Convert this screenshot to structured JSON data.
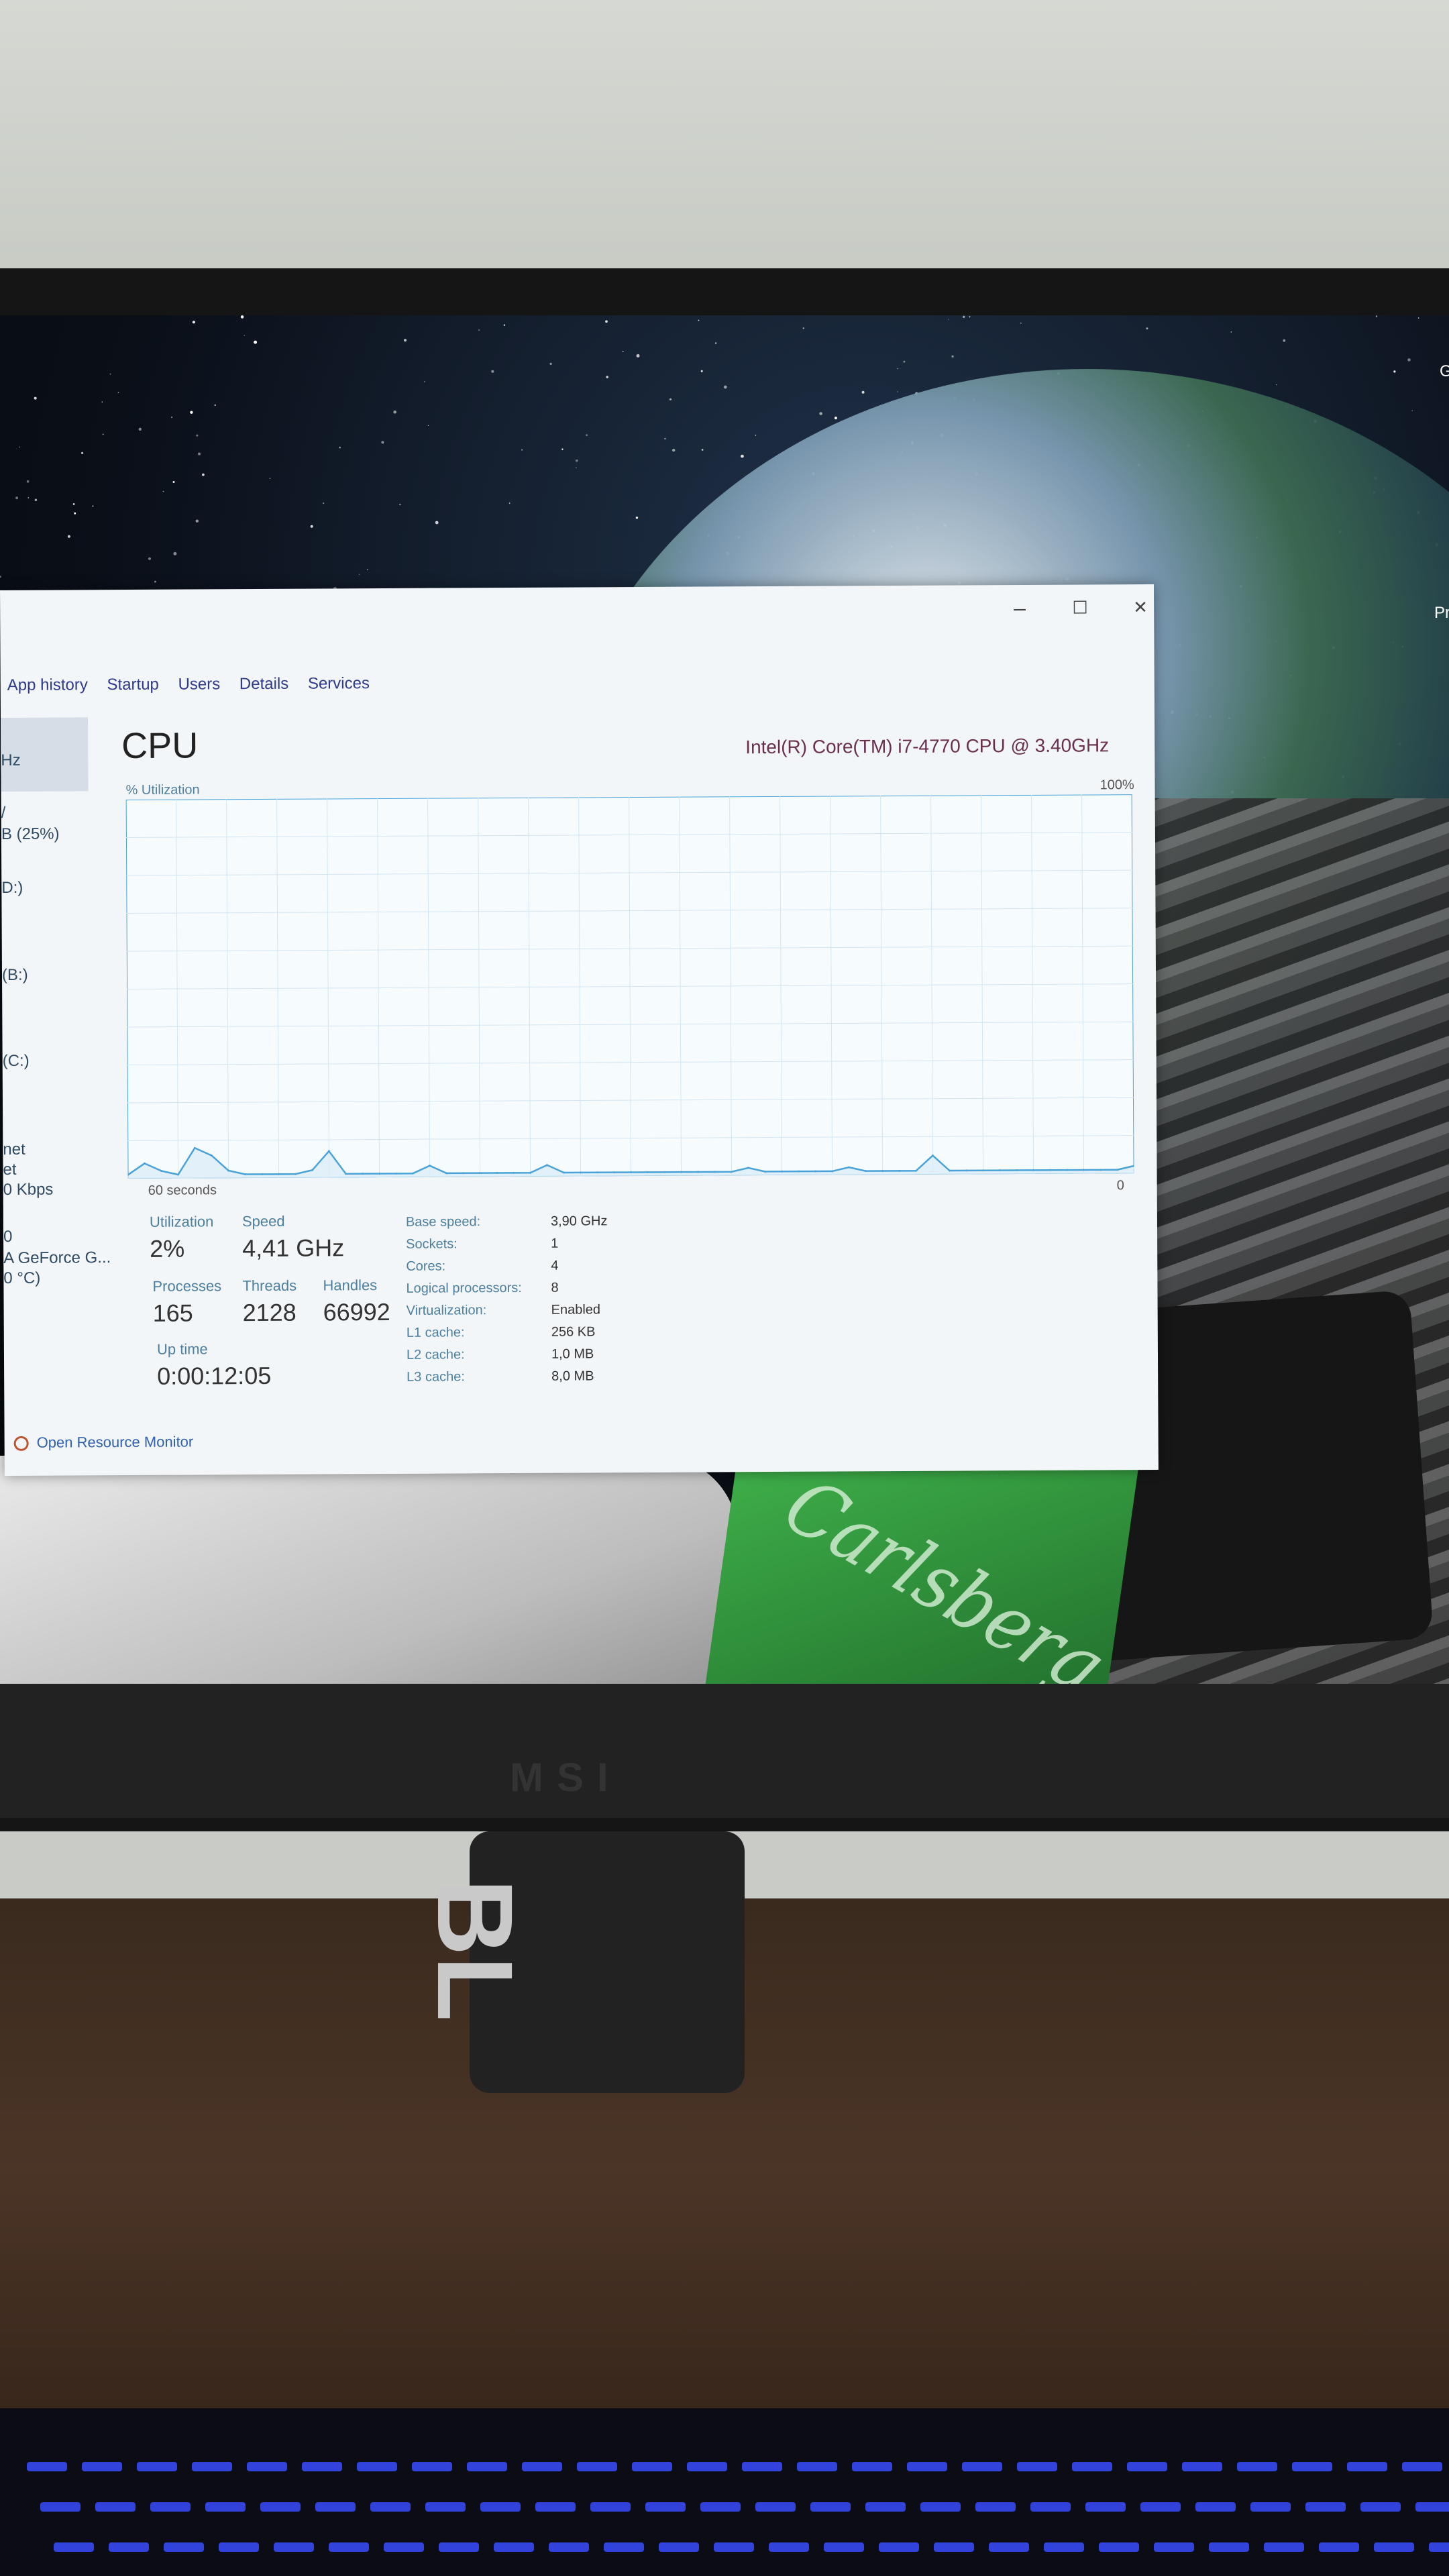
{
  "window": {
    "controls": {
      "minimize": "–",
      "maximize": "☐",
      "close": "✕"
    },
    "tabs": [
      "App history",
      "Startup",
      "Users",
      "Details",
      "Services"
    ]
  },
  "sidebar": {
    "items": [
      "Hz",
      "/",
      "B (25%)",
      "D:)",
      "(B:)",
      "(C:)",
      "net",
      "et",
      "0 Kbps",
      "0",
      "A GeForce G...",
      "0 °C)"
    ]
  },
  "cpu": {
    "title": "CPU",
    "model": "Intel(R) Core(TM) i7-4770 CPU @ 3.40GHz",
    "util_label": "% Utilization",
    "util_max": "100%",
    "time_left": "60 seconds",
    "time_right": "0"
  },
  "stats": {
    "utilization": {
      "label": "Utilization",
      "value": "2%"
    },
    "speed": {
      "label": "Speed",
      "value": "4,41 GHz"
    },
    "processes": {
      "label": "Processes",
      "value": "165"
    },
    "threads": {
      "label": "Threads",
      "value": "2128"
    },
    "handles": {
      "label": "Handles",
      "value": "66992"
    },
    "uptime": {
      "label": "Up time",
      "value": "0:00:12:05"
    }
  },
  "specs": [
    {
      "label": "Base speed:",
      "value": "3,90 GHz"
    },
    {
      "label": "Sockets:",
      "value": "1"
    },
    {
      "label": "Cores:",
      "value": "4"
    },
    {
      "label": "Logical processors:",
      "value": "8"
    },
    {
      "label": "Virtualization:",
      "value": "Enabled"
    },
    {
      "label": "L1 cache:",
      "value": "256 KB"
    },
    {
      "label": "L2 cache:",
      "value": "1,0 MB"
    },
    {
      "label": "L3 cache:",
      "value": "8,0 MB"
    }
  ],
  "footer": {
    "open_resource_monitor": "Open Resource Monitor"
  },
  "desktop": {
    "edge_top_right": "G",
    "edge_right": "Pr"
  },
  "monitor": {
    "brand": "MSI"
  },
  "speaker": {
    "logo": "BL"
  },
  "chart_data": {
    "type": "line",
    "title": "",
    "xlabel": "",
    "ylabel": "% Utilization",
    "xlim": [
      60,
      0
    ],
    "ylim": [
      0,
      100
    ],
    "x": [
      60,
      59,
      58,
      57,
      56,
      55,
      54,
      53,
      52,
      51,
      50,
      49,
      48,
      47,
      46,
      45,
      44,
      43,
      42,
      41,
      40,
      39,
      38,
      37,
      36,
      35,
      34,
      33,
      32,
      31,
      30,
      29,
      28,
      27,
      26,
      25,
      24,
      23,
      22,
      21,
      20,
      19,
      18,
      17,
      16,
      15,
      14,
      13,
      12,
      11,
      10,
      9,
      8,
      7,
      6,
      5,
      4,
      3,
      2,
      1,
      0
    ],
    "series": [
      {
        "values": [
          1,
          4,
          2,
          1,
          8,
          6,
          2,
          1,
          1,
          1,
          1,
          2,
          7,
          1,
          1,
          1,
          1,
          1,
          3,
          1,
          1,
          1,
          1,
          1,
          1,
          3,
          1,
          1,
          1,
          1,
          1,
          1,
          1,
          1,
          1,
          1,
          1,
          2,
          1,
          1,
          1,
          1,
          1,
          2,
          1,
          1,
          1,
          1,
          5,
          1,
          1,
          1,
          1,
          1,
          1,
          1,
          1,
          1,
          1,
          1,
          2
        ]
      }
    ],
    "grid": true,
    "color": "#4aa3d8"
  }
}
